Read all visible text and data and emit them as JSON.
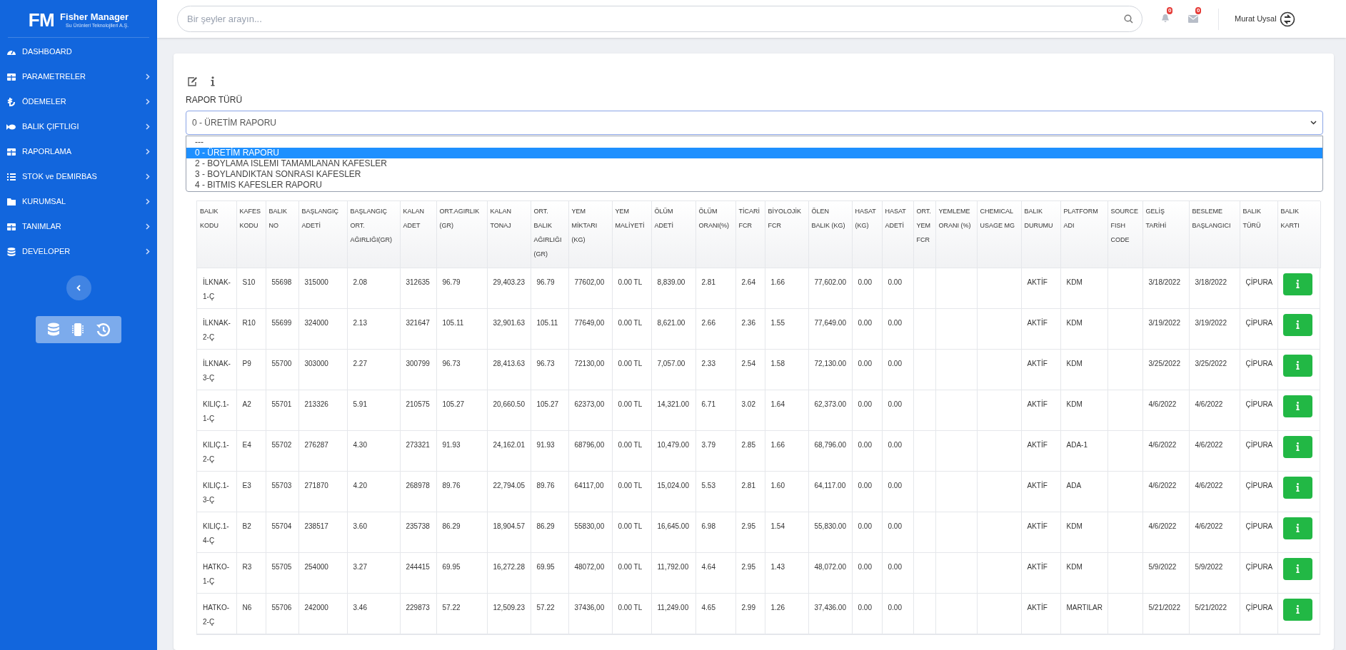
{
  "sidebar": {
    "logo": {
      "mark": "FM",
      "title": "Fisher Manager",
      "subtitle": "Su Ürünleri Teknolojileri A.Ş."
    },
    "items": [
      {
        "label": "DASHBOARD",
        "has_submenu": false
      },
      {
        "label": "PARAMETRELER",
        "has_submenu": true
      },
      {
        "label": "ÖDEMELER",
        "has_submenu": true
      },
      {
        "label": "BALIK ÇIFTLIGI",
        "has_submenu": true
      },
      {
        "label": "RAPORLAMA",
        "has_submenu": true
      },
      {
        "label": "STOK ve DEMIRBAS",
        "has_submenu": true
      },
      {
        "label": "KURUMSAL",
        "has_submenu": true
      },
      {
        "label": "TANIMLAR",
        "has_submenu": true
      },
      {
        "label": "DEVELOPER",
        "has_submenu": true
      }
    ]
  },
  "header": {
    "search": {
      "placeholder": "Bir şeyler arayın..."
    },
    "notifications": "0",
    "messages": "0",
    "user": "Murat Uysal"
  },
  "form": {
    "label": "RAPOR TÜRÜ",
    "select": {
      "value": "0 - ÜRETİM RAPORU",
      "expanded": true,
      "options": [
        {
          "label": "---",
          "selected": false
        },
        {
          "label": "0 - ÜRETİM RAPORU",
          "selected": true
        },
        {
          "label": "2 - BOYLAMA ISLEMI TAMAMLANAN KAFESLER",
          "selected": false
        },
        {
          "label": "3 - BOYLANDIKTAN SONRASI KAFESLER",
          "selected": false
        },
        {
          "label": "4 - BITMIS KAFESLER RAPORU",
          "selected": false
        }
      ]
    }
  },
  "table": {
    "columns": [
      "BALIK KODU",
      "KAFES KODU",
      "BALIK NO",
      "BAŞLANGIÇ ADETİ",
      "BAŞLANGIÇ ORT. AĞIRLIĞI(GR)",
      "KALAN ADET",
      "ORT.AGIRLIK (GR)",
      "KALAN TONAJ",
      "ORT. BALIK AĞIRLIĞI (GR)",
      "YEM MİKTARI (KG)",
      "YEM MALİYETİ",
      "ÖLÜM ADETİ",
      "ÖLÜM ORANI(%)",
      "TİCARİ FCR",
      "BİYOLOJİK FCR",
      "ÖLEN BALIK (KG)",
      "HASAT (KG)",
      "HASAT ADETİ",
      "ORT. YEM FCR",
      "YEMLEME ORANI (%)",
      "CHEMICAL USAGE MG",
      "BALIK DURUMU",
      "PLATFORM ADI",
      "SOURCE FISH CODE",
      "GELİŞ TARİHİ",
      "BESLEME BAŞLANGICI",
      "BALIK TÜRÜ",
      "BALIK KARTI"
    ],
    "rows": [
      [
        "İLKNAK-1-Ç",
        "S10",
        "55698",
        "315000",
        "2.08",
        "312635",
        "96.79",
        "29,403.23",
        "96.79",
        "77602,00",
        "0.00 TL",
        "8,839.00",
        "2.81",
        "2.64",
        "1.66",
        "77,602.00",
        "0.00",
        "0.00",
        null,
        null,
        null,
        "AKTİF",
        "KDM",
        null,
        "3/18/2022",
        "3/18/2022",
        "ÇİPURA"
      ],
      [
        "İLKNAK-2-Ç",
        "R10",
        "55699",
        "324000",
        "2.13",
        "321647",
        "105.11",
        "32,901.63",
        "105.11",
        "77649,00",
        "0.00 TL",
        "8,621.00",
        "2.66",
        "2.36",
        "1.55",
        "77,649.00",
        "0.00",
        "0.00",
        null,
        null,
        null,
        "AKTİF",
        "KDM",
        null,
        "3/19/2022",
        "3/19/2022",
        "ÇİPURA"
      ],
      [
        "İLKNAK-3-Ç",
        "P9",
        "55700",
        "303000",
        "2.27",
        "300799",
        "96.73",
        "28,413.63",
        "96.73",
        "72130,00",
        "0.00 TL",
        "7,057.00",
        "2.33",
        "2.54",
        "1.58",
        "72,130.00",
        "0.00",
        "0.00",
        null,
        null,
        null,
        "AKTİF",
        "KDM",
        null,
        "3/25/2022",
        "3/25/2022",
        "ÇİPURA"
      ],
      [
        "KILIÇ.1-1-Ç",
        "A2",
        "55701",
        "213326",
        "5.91",
        "210575",
        "105.27",
        "20,660.50",
        "105.27",
        "62373,00",
        "0.00 TL",
        "14,321.00",
        "6.71",
        "3.02",
        "1.64",
        "62,373.00",
        "0.00",
        "0.00",
        null,
        null,
        null,
        "AKTİF",
        "KDM",
        null,
        "4/6/2022",
        "4/6/2022",
        "ÇİPURA"
      ],
      [
        "KILIÇ.1-2-Ç",
        "E4",
        "55702",
        "276287",
        "4.30",
        "273321",
        "91.93",
        "24,162.01",
        "91.93",
        "68796,00",
        "0.00 TL",
        "10,479.00",
        "3.79",
        "2.85",
        "1.66",
        "68,796.00",
        "0.00",
        "0.00",
        null,
        null,
        null,
        "AKTİF",
        "ADA-1",
        null,
        "4/6/2022",
        "4/6/2022",
        "ÇİPURA"
      ],
      [
        "KILIÇ.1-3-Ç",
        "E3",
        "55703",
        "271870",
        "4.20",
        "268978",
        "89.76",
        "22,794.05",
        "89.76",
        "64117,00",
        "0.00 TL",
        "15,024.00",
        "5.53",
        "2.81",
        "1.60",
        "64,117.00",
        "0.00",
        "0.00",
        null,
        null,
        null,
        "AKTİF",
        "ADA",
        null,
        "4/6/2022",
        "4/6/2022",
        "ÇİPURA"
      ],
      [
        "KILIÇ.1-4-Ç",
        "B2",
        "55704",
        "238517",
        "3.60",
        "235738",
        "86.29",
        "18,904.57",
        "86.29",
        "55830,00",
        "0.00 TL",
        "16,645.00",
        "6.98",
        "2.95",
        "1.54",
        "55,830.00",
        "0.00",
        "0.00",
        null,
        null,
        null,
        "AKTİF",
        "KDM",
        null,
        "4/6/2022",
        "4/6/2022",
        "ÇİPURA"
      ],
      [
        "HATKO-1-Ç",
        "R3",
        "55705",
        "254000",
        "3.27",
        "244415",
        "69.95",
        "16,272.28",
        "69.95",
        "48072,00",
        "0.00 TL",
        "11,792.00",
        "4.64",
        "2.95",
        "1.43",
        "48,072.00",
        "0.00",
        "0.00",
        null,
        null,
        null,
        "AKTİF",
        "KDM",
        null,
        "5/9/2022",
        "5/9/2022",
        "ÇİPURA"
      ],
      [
        "HATKO-2-Ç",
        "N6",
        "55706",
        "242000",
        "3.46",
        "229873",
        "57.22",
        "12,509.23",
        "57.22",
        "37436,00",
        "0.00 TL",
        "11,249.00",
        "4.65",
        "2.99",
        "1.26",
        "37,436.00",
        "0.00",
        "0.00",
        null,
        null,
        null,
        "AKTİF",
        "MARTILAR",
        null,
        "5/21/2022",
        "5/21/2022",
        "ÇİPURA"
      ]
    ]
  }
}
